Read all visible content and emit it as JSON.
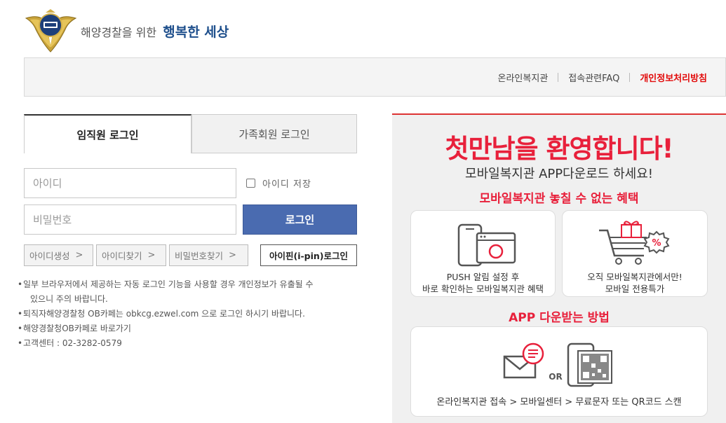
{
  "brand": {
    "prefix": "해양경찰을 위한",
    "highlight": "행복한 세상"
  },
  "topnav": {
    "items": [
      "온라인복지관",
      "접속관련FAQ",
      "개인정보처리방침"
    ],
    "accent_color": "#e20a0a"
  },
  "tabs": {
    "employee": "임직원 로그인",
    "family": "가족회원 로그인"
  },
  "form": {
    "id_placeholder": "아이디",
    "pw_placeholder": "비밀번호",
    "save_id_label": "아이디 저장",
    "login_label": "로그인"
  },
  "links": {
    "create_id": "아이디생성",
    "find_id": "아이디찾기",
    "find_pw": "비밀번호찾기",
    "ipin": "아이핀(i-pin)로그인"
  },
  "notes": {
    "line1": "일부 브라우저에서 제공하는 자동 로그인 기능을 사용할 경우 개인정보가 유출될 수",
    "line1_cont": "있으니 주의 바랍니다.",
    "line2": "퇴직자해양경찰청 OB카페는 obkcg.ezwel.com 으로 로그인 하시기 바랍니다.",
    "line3": "해양경찰청OB카페로 바로가기",
    "line4": "고객센터 : 02-3282-0579"
  },
  "promo": {
    "title": "첫만남을 환영합니다!",
    "subtitle": "모바일복지관 APP다운로드 하세요!",
    "benefits_heading": "모바일복지관 놓칠 수 없는 혜택",
    "card1_line1": "PUSH 알림 설정 후",
    "card1_line2": "바로 확인하는 모바일복지관 혜택",
    "card2_line1": "오직 모바일복지관에서만!",
    "card2_line2": "모바일 전용특가",
    "download_heading": "APP 다운받는 방법",
    "or_label": "OR",
    "download_caption": "온라인복지관 접속 > 모바일센터 > 무료문자 또는 QR코드 스캔",
    "accent_color": "#e8203b"
  },
  "icons": [
    "police-emblem-icon",
    "push-phone-icon",
    "sale-cart-icon",
    "sms-envelope-icon",
    "qr-phone-icon",
    "chevron-right-icon"
  ]
}
